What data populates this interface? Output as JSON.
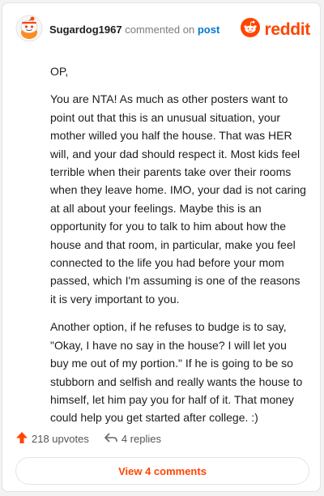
{
  "header": {
    "username": "Sugardog1967",
    "action_text": "commented on",
    "post_link": "post",
    "brand_name": "reddit"
  },
  "comment": {
    "paragraphs": [
      "OP,",
      "You are NTA! As much as other posters want to point out that this is an unusual situation, your mother willed you half the house. That was HER will, and your dad should respect it. Most kids feel terrible when their parents take over their rooms when they leave home. IMO, your dad is not caring at all about your feelings. Maybe this is an opportunity for you to talk to him about how the house and that room, in particular, make you feel connected to the life you had before your mom passed, which I'm assuming is one of the reasons it is very important to you.",
      "Another option, if he refuses to budge is to say, \"Okay, I have no say in the house? I will let you buy me out of my portion.\" If he is going to be so stubborn and selfish and really wants the house to himself, let him pay you for half of it. That money could help you get started after college. :)"
    ]
  },
  "actions": {
    "upvotes_label": "218 upvotes",
    "replies_label": "4 replies"
  },
  "footer": {
    "view_comments_label": "View 4 comments"
  },
  "colors": {
    "brand": "#ff4500",
    "link": "#0079d3",
    "text": "#1c1c1c",
    "muted": "#7c7c7c"
  },
  "icons": {
    "avatar": "snoo-avatar-icon",
    "brand": "reddit-logo-icon",
    "upvote": "upvote-arrow-icon",
    "reply": "reply-arrow-icon"
  }
}
